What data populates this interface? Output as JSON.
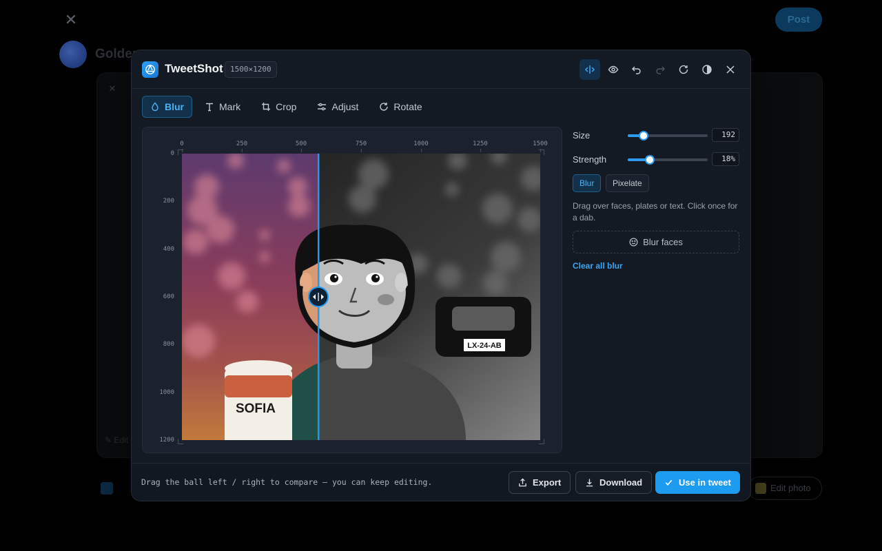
{
  "background": {
    "post_label": "Post",
    "author_name": "Golden",
    "edit_hint": "✎ Edit",
    "edit_photo_label": "Edit photo"
  },
  "header": {
    "app_name": "TweetShot",
    "dimensions": "1500×1200",
    "icons": [
      "compare-icon",
      "eye-icon",
      "undo-icon",
      "redo-icon",
      "reset-icon",
      "contrast-icon",
      "close-icon"
    ]
  },
  "toolbar": {
    "tabs": [
      {
        "label": "Blur",
        "icon": "blur-drop-icon",
        "active": true
      },
      {
        "label": "Mark",
        "icon": "text-mark-icon",
        "active": false
      },
      {
        "label": "Crop",
        "icon": "crop-icon",
        "active": false
      },
      {
        "label": "Adjust",
        "icon": "sliders-icon",
        "active": false
      },
      {
        "label": "Rotate",
        "icon": "rotate-icon",
        "active": false
      }
    ]
  },
  "rulers": {
    "top": [
      "0",
      "250",
      "500",
      "750",
      "1000",
      "1250",
      "1500"
    ],
    "left": [
      "0",
      "200",
      "400",
      "600",
      "800",
      "1000",
      "1200"
    ]
  },
  "image": {
    "mug_text": "SOFIA",
    "plate_text": "LX-24-AB",
    "compare_split": 0.38
  },
  "panel": {
    "size_label": "Size",
    "size_value": "192",
    "size_level": 0.2,
    "strength_label": "Strength",
    "strength_value": "18%",
    "strength_level": 0.28,
    "modes": [
      {
        "label": "Blur",
        "active": true
      },
      {
        "label": "Pixelate",
        "active": false
      }
    ],
    "hint": "Drag over faces, plates or text. Click once for a dab.",
    "blur_faces_label": "Blur faces",
    "clear_label": "Clear all blur"
  },
  "footer": {
    "hint": "Drag the ball left / right to compare — you can keep editing.",
    "export_label": "Export",
    "download_label": "Download",
    "use_label": "Use in tweet"
  },
  "colors": {
    "accent": "#1d9bf0",
    "modal_bg": "#141a23"
  }
}
